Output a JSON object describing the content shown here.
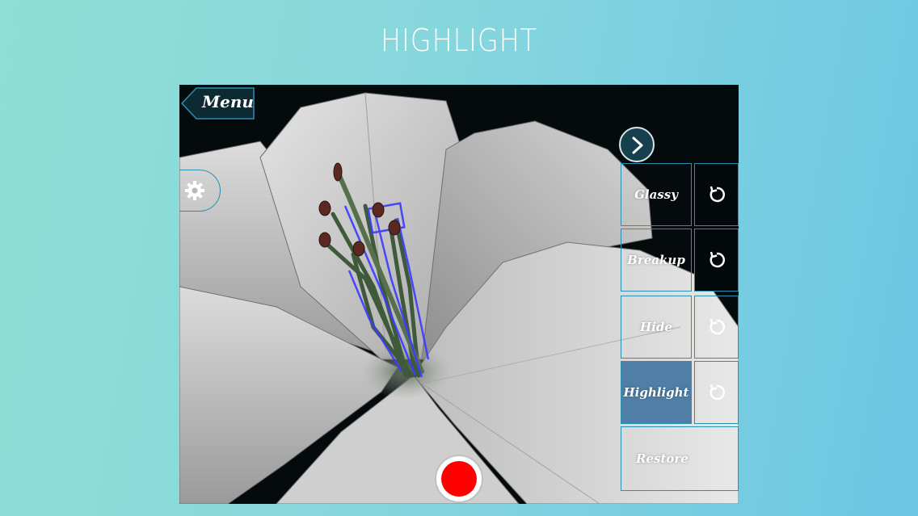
{
  "page": {
    "title": "HIGHLIGHT"
  },
  "app": {
    "menu_label": "Menu",
    "settings_icon": "gear-icon",
    "next_icon": "chevron-right-icon",
    "options": [
      {
        "label": "Glassy",
        "active": false
      },
      {
        "label": "Breakup",
        "active": false
      },
      {
        "label": "Hide",
        "active": false
      },
      {
        "label": "Highlight",
        "active": true
      }
    ],
    "reset_icon": "reset-icon",
    "restore_label": "Restore",
    "record_icon": "record-icon",
    "colors": {
      "accent_border": "#2a8fb0",
      "active_option": "#4f7fa6",
      "record": "#ff0000",
      "highlight_outline": "#3b3bff"
    }
  }
}
